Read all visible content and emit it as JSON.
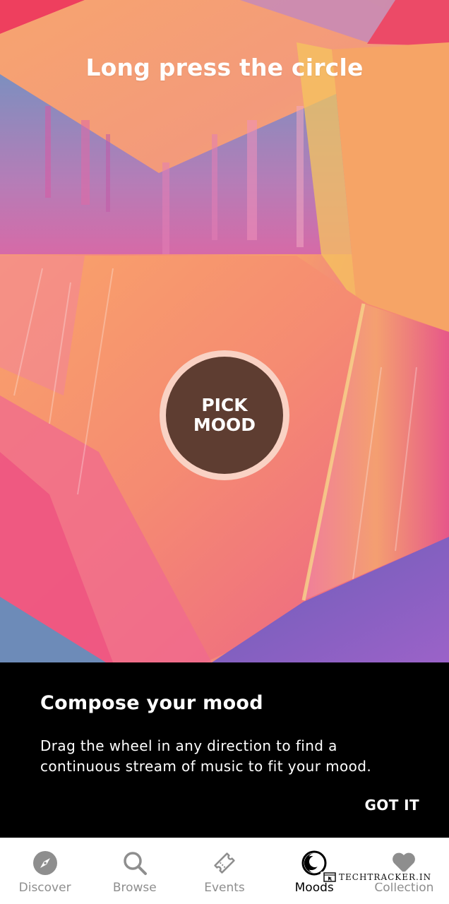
{
  "hero": {
    "title": "Long press the circle",
    "circle_label_line1": "PICK",
    "circle_label_line2": "MOOD"
  },
  "coach": {
    "title": "Compose your mood",
    "body": "Drag the wheel in any direction to find a continuous stream of music to fit your mood.",
    "button": "GOT IT"
  },
  "nav": {
    "items": [
      {
        "label": "Discover",
        "icon": "compass-icon",
        "active": false
      },
      {
        "label": "Browse",
        "icon": "search-icon",
        "active": false
      },
      {
        "label": "Events",
        "icon": "ticket-icon",
        "active": false
      },
      {
        "label": "Moods",
        "icon": "moon-icon",
        "active": true
      },
      {
        "label": "Collection",
        "icon": "heart-icon",
        "active": false
      }
    ]
  },
  "watermark": "TECHTRACKER.IN",
  "colors": {
    "coach_bg": "#000000",
    "circle_ring": "#f9d2c4",
    "circle_fill": "#5e3d31",
    "nav_inactive": "#8e8e8e",
    "nav_active": "#000000"
  }
}
